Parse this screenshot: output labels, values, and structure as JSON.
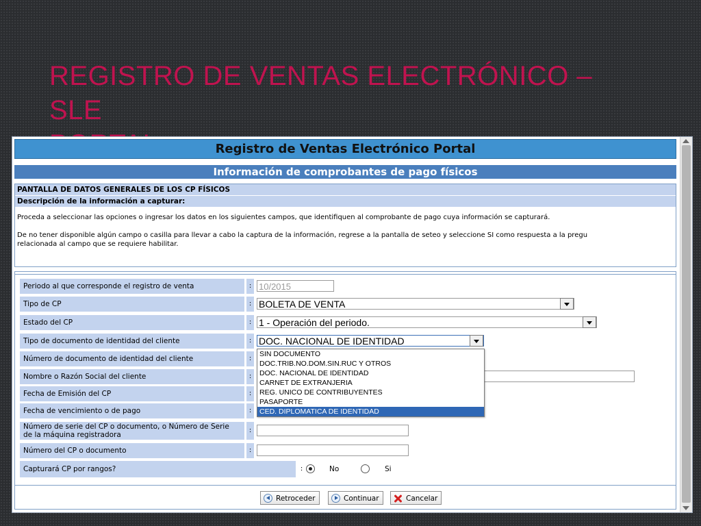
{
  "slide": {
    "title_line1": "Registro de Ventas Electrónico – SLE",
    "title_line2": "Portal"
  },
  "colors": {
    "slide_title": "#c0134f",
    "header_blue": "#3f92d0",
    "section_blue": "#4a7fbd",
    "label_bg": "#c3d3ee",
    "selected_option": "#2f67b5"
  },
  "window": {
    "portal_title": "Registro de Ventas Electrónico Portal",
    "section_title": "Información de comprobantes de pago físicos"
  },
  "info": {
    "heading": "PANTALLA DE DATOS GENERALES DE LOS CP FÍSICOS",
    "subheading": "Descripción de la información a capturar:",
    "paragraph1": "Proceda a seleccionar las opciones o ingresar los datos en los siguientes campos, que identifiquen al comprobante de pago cuya información se capturará.",
    "paragraph2_line1": "De no tener disponible algún campo o casilla para llevar a cabo la captura de la información, regrese a la pantalla de seteo y seleccione SI como respuesta a la pregu",
    "paragraph2_line2": "relacionada al campo que se requiere habilitar."
  },
  "form": {
    "colon": ":",
    "periodo": {
      "label": "Periodo al que corresponde el registro de venta",
      "value": "10/2015"
    },
    "tipo_cp": {
      "label": "Tipo de CP",
      "value": "BOLETA DE VENTA"
    },
    "estado_cp": {
      "label": "Estado del CP",
      "value": "1 - Operación del periodo."
    },
    "tipo_doc": {
      "label": "Tipo de documento de identidad del cliente",
      "value": "DOC. NACIONAL DE IDENTIDAD"
    },
    "num_doc": {
      "label": "Número de documento de identidad del cliente",
      "value": ""
    },
    "nombre": {
      "label": "Nombre o Razón Social del cliente",
      "value": ""
    },
    "fecha_emision": {
      "label": "Fecha de Emisión del CP",
      "value": ""
    },
    "fecha_venc": {
      "label": "Fecha de vencimiento o de pago",
      "value": ""
    },
    "serie": {
      "label_line1": "Número de serie del CP o documento, o Número de Serie",
      "label_line2": "de la máquina registradora",
      "value": ""
    },
    "numero_cp": {
      "label": "Número del CP o documento",
      "value": ""
    },
    "rangos": {
      "label": "Capturará CP por rangos?",
      "option_no": "No",
      "option_si": "Si",
      "selected": "No"
    }
  },
  "dropdown_options": [
    "SIN DOCUMENTO",
    "DOC.TRIB.NO.DOM.SIN.RUC Y OTROS",
    "DOC. NACIONAL DE IDENTIDAD",
    "CARNET DE EXTRANJERIA",
    "REG. UNICO DE CONTRIBUYENTES",
    "PASAPORTE",
    "CED. DIPLOMATICA DE IDENTIDAD"
  ],
  "dropdown_selected_index": 6,
  "buttons": {
    "back": "Retroceder",
    "next": "Continuar",
    "cancel": "Cancelar"
  }
}
